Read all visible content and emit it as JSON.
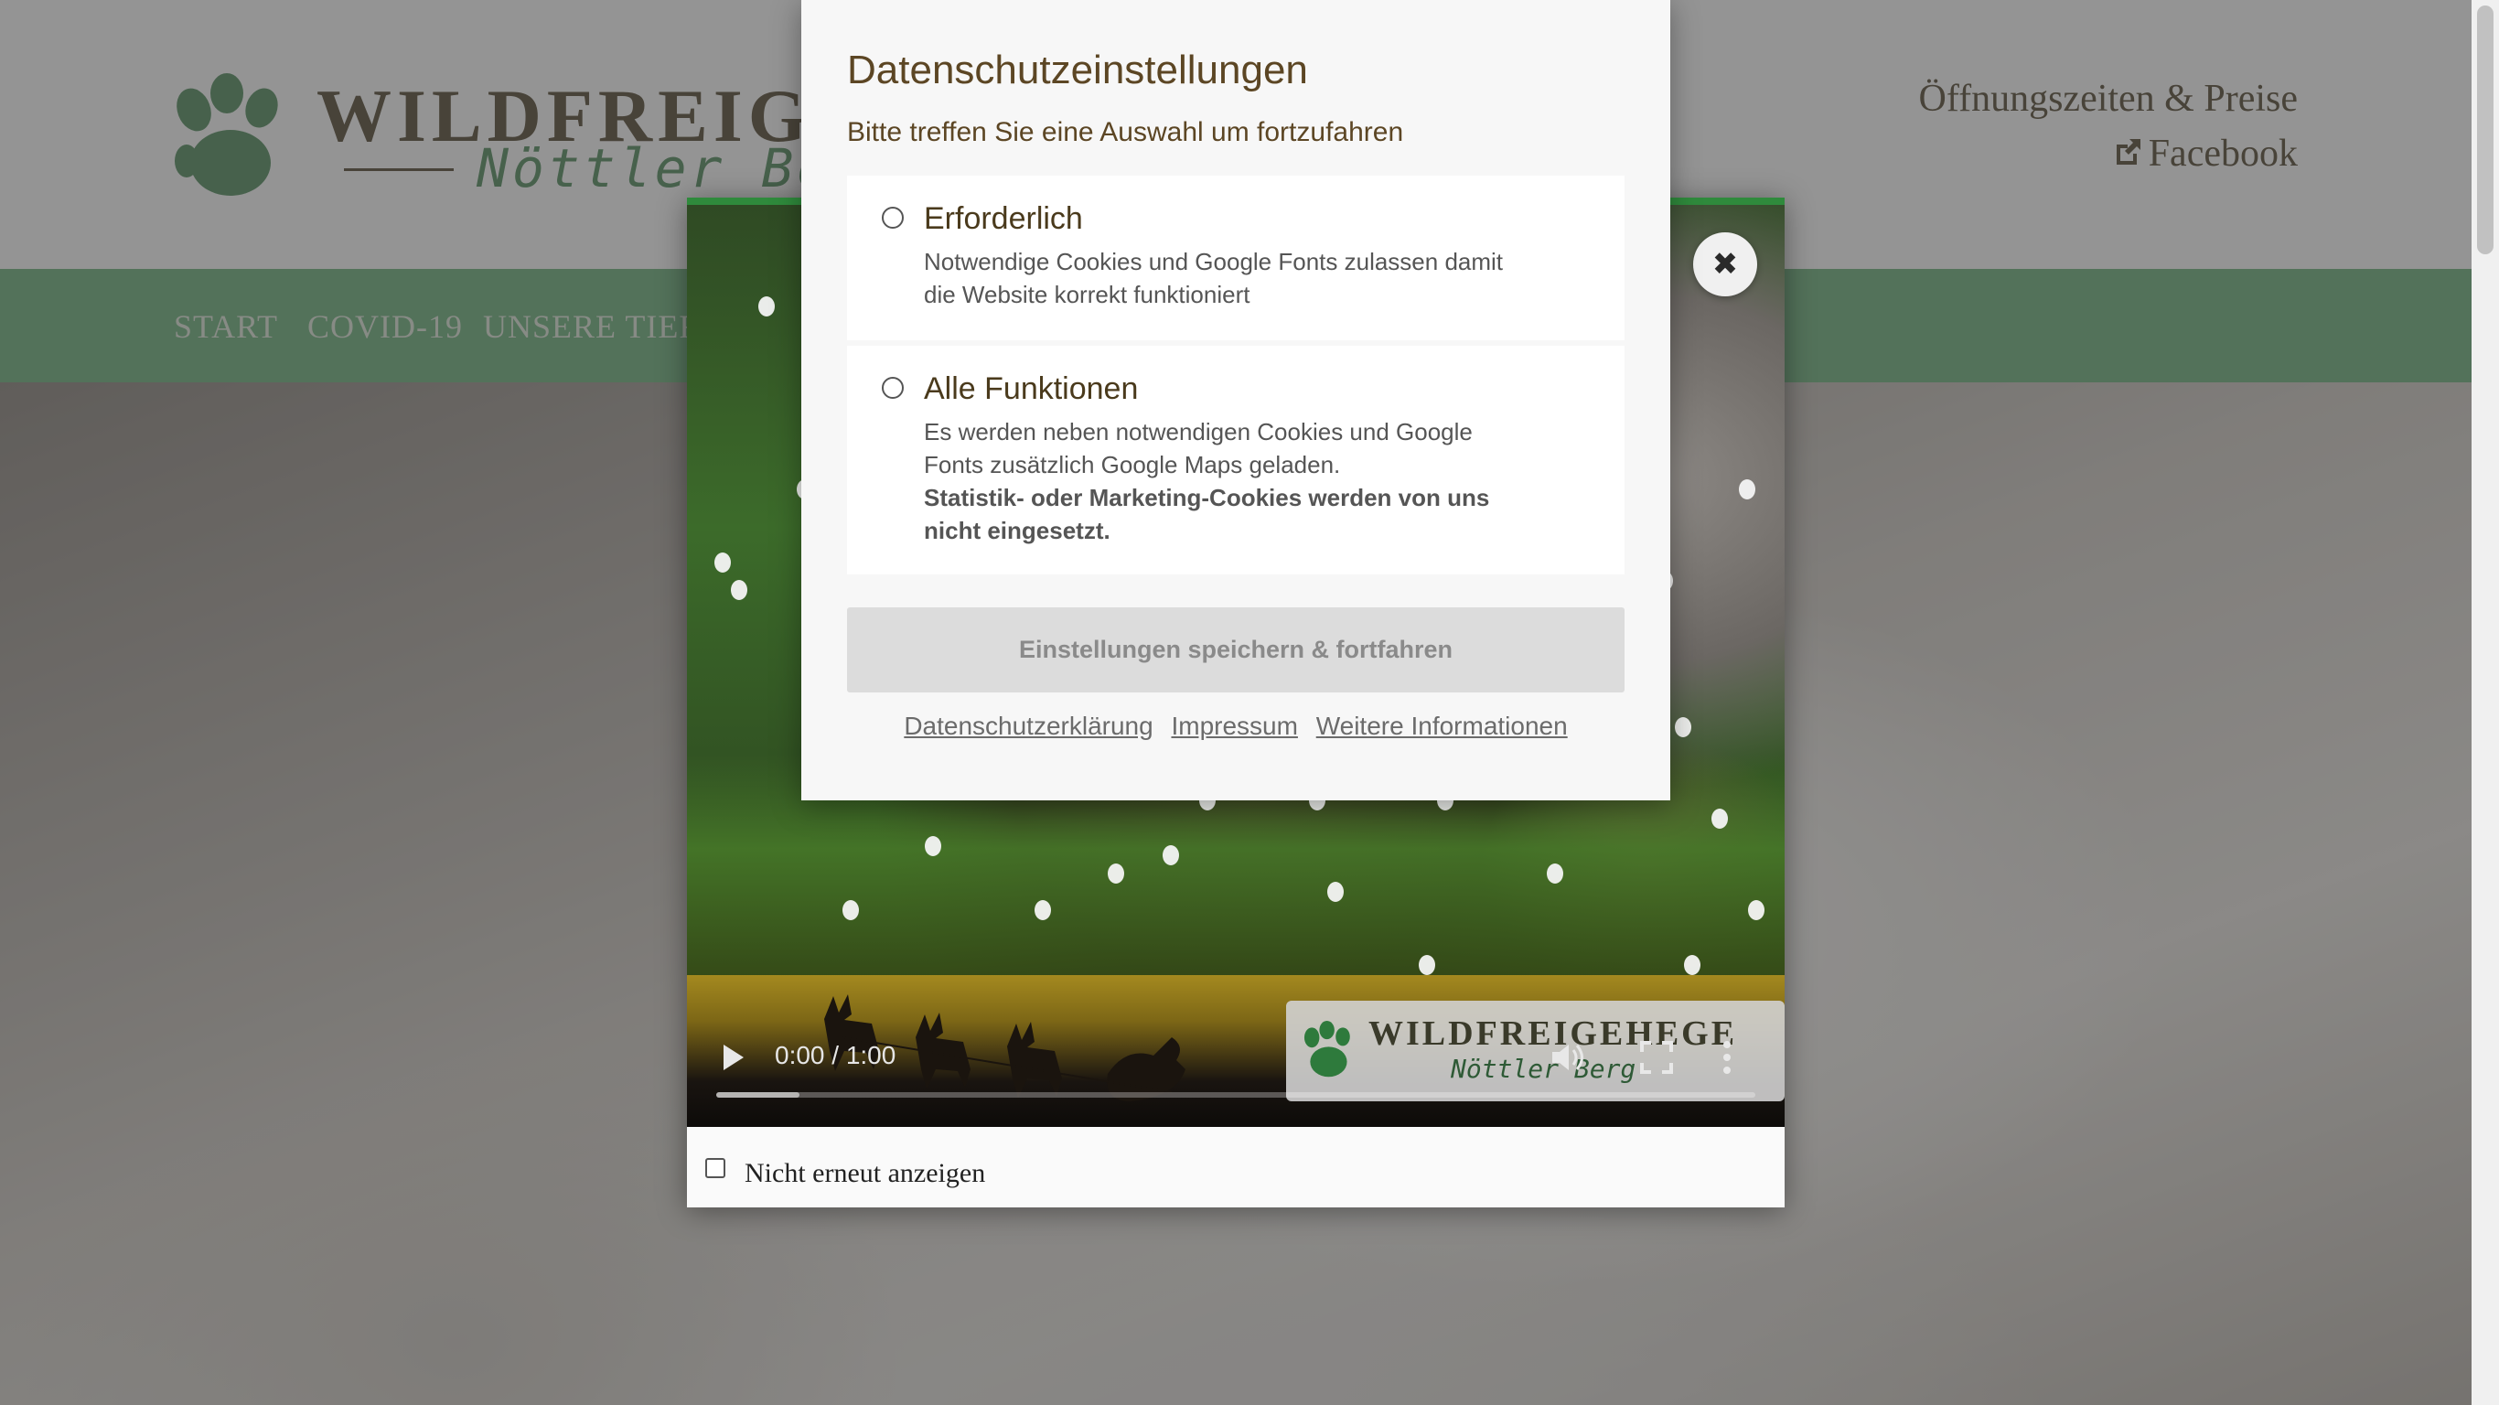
{
  "site": {
    "logo_title": "WILDFREIGEHE",
    "logo_subtitle": "Nöttler Berg",
    "header_links": [
      "Öffnungszeiten & Preise",
      "Facebook"
    ],
    "nav": [
      "START",
      "COVID-19",
      "UNSERE TIERE"
    ]
  },
  "video_popup": {
    "time": "0:00 / 1:00",
    "progress_buffered": 0.08,
    "logo_title": "WILDFREIGEHEGE",
    "logo_subtitle": "Nöttler Berg",
    "dont_show_label": "Nicht erneut anzeigen",
    "close_glyph": "✖"
  },
  "privacy": {
    "title": "Datenschutzeinstellungen",
    "subtitle": "Bitte treffen Sie eine Auswahl um fortzufahren",
    "options": [
      {
        "label": "Erforderlich",
        "description": "Notwendige Cookies und Google Fonts zulassen damit die Website korrekt funktioniert"
      },
      {
        "label": "Alle Funktionen",
        "description": "Es werden neben notwendigen Cookies und Google Fonts zusätzlich Google Maps geladen.",
        "note": "Statistik- oder Marketing-Cookies werden von uns nicht eingesetzt."
      }
    ],
    "save_label": "Einstellungen speichern & fortfahren",
    "links": [
      "Datenschutzerklärung",
      "Impressum",
      "Weitere Informationen"
    ]
  },
  "colors": {
    "nav_green": "#8fc49c",
    "brand_brown": "#7d7462",
    "dialog_title": "#5c4624",
    "video_border": "#2f8a3c"
  },
  "icons": [
    "paw-icon",
    "external-link-icon",
    "close-icon",
    "play-icon",
    "volume-icon",
    "fullscreen-icon",
    "more-icon"
  ]
}
